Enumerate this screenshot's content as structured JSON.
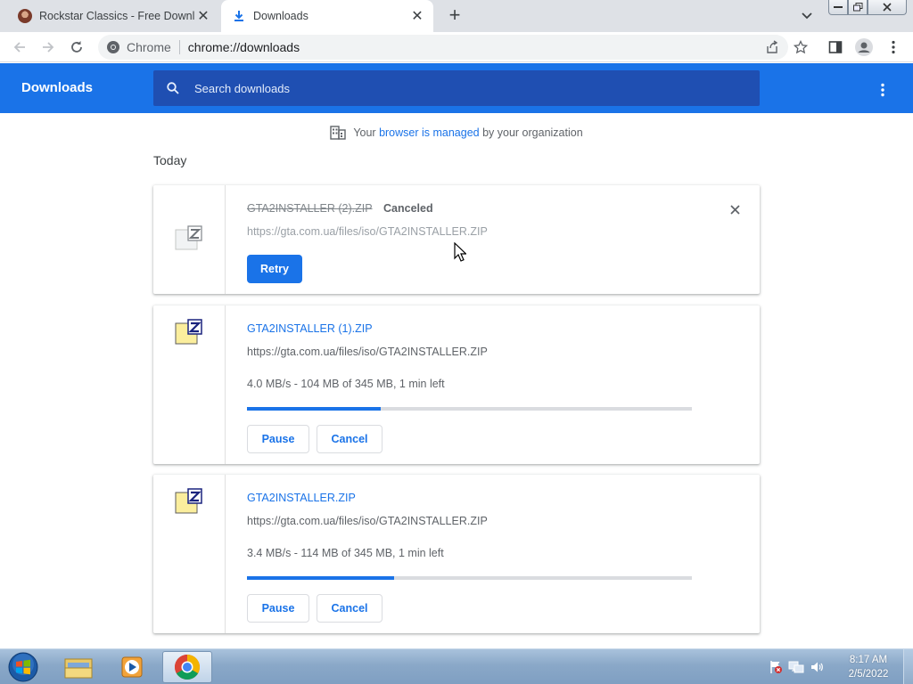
{
  "browser": {
    "tabs": [
      {
        "title": "Rockstar Classics - Free Downloa",
        "active": false
      },
      {
        "title": "Downloads",
        "active": true
      }
    ],
    "omnibox": {
      "chip": "Chrome",
      "url": "chrome://downloads"
    }
  },
  "downloads_page": {
    "heading": "Downloads",
    "search_placeholder": "Search downloads",
    "managed_notice": {
      "prefix": "Your ",
      "link": "browser is managed",
      "suffix": " by your organization"
    },
    "section_title": "Today",
    "items": [
      {
        "filename": "GTA2INSTALLER (2).ZIP",
        "status": "Canceled",
        "source_url": "https://gta.com.ua/files/iso/GTA2INSTALLER.ZIP",
        "retry_label": "Retry"
      },
      {
        "filename": "GTA2INSTALLER (1).ZIP",
        "source_url": "https://gta.com.ua/files/iso/GTA2INSTALLER.ZIP",
        "progress_text": "4.0 MB/s - 104 MB of 345 MB, 1 min left",
        "progress_fraction": 0.301,
        "pause_label": "Pause",
        "cancel_label": "Cancel"
      },
      {
        "filename": "GTA2INSTALLER.ZIP",
        "source_url": "https://gta.com.ua/files/iso/GTA2INSTALLER.ZIP",
        "progress_text": "3.4 MB/s - 114 MB of 345 MB, 1 min left",
        "progress_fraction": 0.33,
        "pause_label": "Pause",
        "cancel_label": "Cancel"
      }
    ]
  },
  "taskbar": {
    "apps": [
      "start-orb",
      "windows-explorer",
      "media-player",
      "google-chrome"
    ],
    "clock": {
      "time": "8:17 AM",
      "date": "2/5/2022"
    }
  },
  "colors": {
    "accent": "#1a73e8",
    "header": "#1a73e8",
    "search_bg": "#1f4fb2"
  }
}
